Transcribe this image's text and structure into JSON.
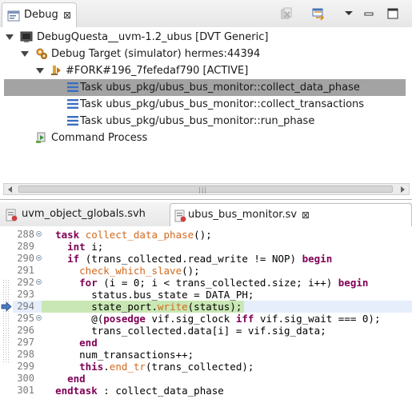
{
  "debug_view": {
    "tab_label": "Debug",
    "tab_close": "⊠",
    "toolbar": [
      "remove-all-terminated-icon",
      "link-with-editor-icon",
      "view-menu-icon",
      "minimize-icon",
      "maximize-icon"
    ],
    "tree": [
      {
        "label": "DebugQuesta__uvm-1.2_ubus [DVT Generic]",
        "icon": "launch-config-icon",
        "expanded": true
      },
      {
        "label": "Debug Target (simulator) hermes:44394",
        "icon": "debug-target-icon",
        "expanded": true
      },
      {
        "label": "#FORK#196_7fefedaf790 [ACTIVE]",
        "icon": "thread-icon",
        "expanded": true
      },
      {
        "label": "Task ubus_pkg/ubus_bus_monitor::collect_data_phase",
        "icon": "stack-frame-icon",
        "selected": true
      },
      {
        "label": "Task ubus_pkg/ubus_bus_monitor::collect_transactions",
        "icon": "stack-frame-icon"
      },
      {
        "label": "Task ubus_pkg/ubus_bus_monitor::run_phase",
        "icon": "stack-frame-icon"
      },
      {
        "label": "Command Process",
        "icon": "process-icon"
      }
    ],
    "scroll_grip": "|||"
  },
  "editor": {
    "tabs": [
      {
        "label": "uvm_object_globals.svh",
        "active": false
      },
      {
        "label": "ubus_bus_monitor.sv",
        "active": true,
        "close": "⊠"
      }
    ],
    "current_line": "294",
    "lines": [
      {
        "num": "288",
        "fold": true,
        "indent": 2,
        "tokens": [
          [
            "kw",
            "task "
          ],
          [
            "fn",
            "collect_data_phase"
          ],
          [
            "plain",
            "();"
          ]
        ]
      },
      {
        "num": "289",
        "fold": false,
        "indent": 4,
        "tokens": [
          [
            "kw",
            "int "
          ],
          [
            "plain",
            "i;"
          ]
        ]
      },
      {
        "num": "290",
        "fold": true,
        "indent": 4,
        "tokens": [
          [
            "kw",
            "if "
          ],
          [
            "plain",
            "(trans_collected.read_write != NOP) "
          ],
          [
            "kw",
            "begin"
          ]
        ]
      },
      {
        "num": "291",
        "fold": false,
        "indent": 6,
        "tokens": [
          [
            "fn",
            "check_which_slave"
          ],
          [
            "plain",
            "();"
          ]
        ]
      },
      {
        "num": "292",
        "fold": true,
        "indent": 6,
        "tokens": [
          [
            "kw",
            "for "
          ],
          [
            "plain",
            "(i = 0; i < trans_collected.size; i++) "
          ],
          [
            "kw",
            "begin"
          ]
        ]
      },
      {
        "num": "293",
        "fold": false,
        "indent": 8,
        "tokens": [
          [
            "plain",
            "status.bus_state = DATA_PH;"
          ]
        ]
      },
      {
        "num": "294",
        "fold": false,
        "indent": 8,
        "tokens": [
          [
            "plain",
            "state_port."
          ],
          [
            "fn",
            "write"
          ],
          [
            "plain",
            "(status);"
          ]
        ]
      },
      {
        "num": "295",
        "fold": true,
        "indent": 8,
        "tokens": [
          [
            "plain",
            "@("
          ],
          [
            "kw",
            "posedge "
          ],
          [
            "plain",
            "vif.sig_clock "
          ],
          [
            "kw",
            "iff "
          ],
          [
            "plain",
            "vif.sig_wait === 0);"
          ]
        ]
      },
      {
        "num": "296",
        "fold": false,
        "indent": 8,
        "tokens": [
          [
            "plain",
            "trans_collected.data[i] = vif.sig_data;"
          ]
        ]
      },
      {
        "num": "297",
        "fold": false,
        "indent": 6,
        "tokens": [
          [
            "kw",
            "end"
          ]
        ]
      },
      {
        "num": "298",
        "fold": false,
        "indent": 6,
        "tokens": [
          [
            "plain",
            "num_transactions++;"
          ]
        ]
      },
      {
        "num": "299",
        "fold": false,
        "indent": 6,
        "tokens": [
          [
            "kw",
            "this"
          ],
          [
            "plain",
            "."
          ],
          [
            "fn",
            "end_tr"
          ],
          [
            "plain",
            "(trans_collected);"
          ]
        ]
      },
      {
        "num": "300",
        "fold": false,
        "indent": 4,
        "tokens": [
          [
            "kw",
            "end"
          ]
        ]
      },
      {
        "num": "301",
        "fold": false,
        "indent": 2,
        "tokens": [
          [
            "kw",
            "endtask "
          ],
          [
            "plain",
            ": collect_data_phase"
          ]
        ]
      }
    ]
  },
  "colors": {
    "selection": "#a3a3a3",
    "current_line_bg": "#e6eefc",
    "current_stmt_bg": "#c9e7b4",
    "keyword": "#7f0055",
    "function": "#d2691e"
  }
}
